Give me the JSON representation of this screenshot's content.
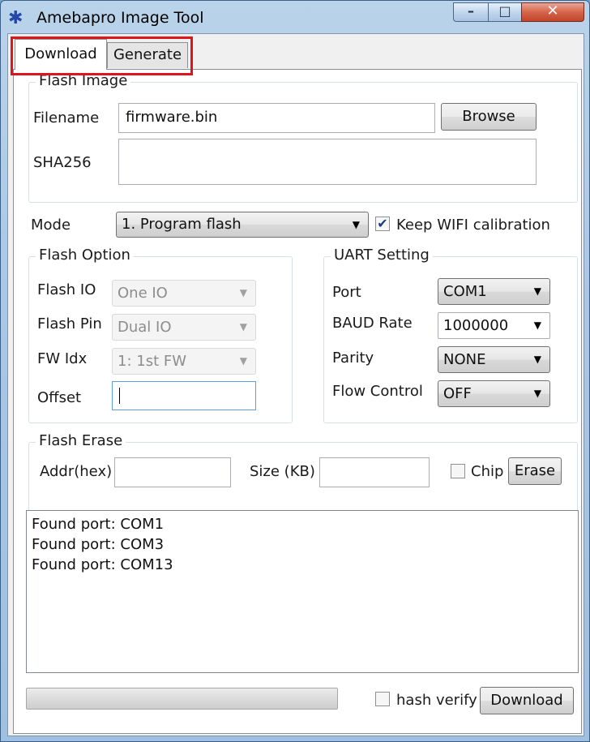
{
  "window": {
    "title": "Amebapro Image Tool",
    "minimize_glyph": "–",
    "maximize_glyph": "□",
    "close_glyph": "✕",
    "app_icon_glyph": "✱"
  },
  "tabs": [
    {
      "label": "Download",
      "selected": true
    },
    {
      "label": "Generate",
      "selected": false
    }
  ],
  "flash_image": {
    "title": "Flash Image",
    "filename_label": "Filename",
    "filename_value": "firmware.bin",
    "browse_label": "Browse",
    "sha_label": "SHA256",
    "sha_value": ""
  },
  "mode": {
    "label": "Mode",
    "selected": "1. Program flash",
    "keep_wifi_label": "Keep WIFI calibration",
    "keep_wifi_checked": true,
    "check_glyph": "✔"
  },
  "flash_option": {
    "title": "Flash Option",
    "io_label": "Flash IO",
    "io_value": "One IO",
    "pin_label": "Flash Pin",
    "pin_value": "Dual IO",
    "fw_label": "FW Idx",
    "fw_value": "1: 1st FW",
    "offset_label": "Offset",
    "offset_value": ""
  },
  "uart": {
    "title": "UART Setting",
    "port_label": "Port",
    "port_value": "COM1",
    "baud_label": "BAUD Rate",
    "baud_value": "1000000",
    "parity_label": "Parity",
    "parity_value": "NONE",
    "flow_label": "Flow Control",
    "flow_value": "OFF"
  },
  "flash_erase": {
    "title": "Flash Erase",
    "addr_label": "Addr(hex)",
    "addr_value": "",
    "size_label": "Size (KB)",
    "size_value": "",
    "chip_label": "Chip",
    "chip_checked": false,
    "erase_label": "Erase"
  },
  "log": {
    "lines": [
      "Found port: COM1",
      "Found port: COM3",
      "Found port: COM13"
    ]
  },
  "footer": {
    "progress": 0,
    "hash_verify_label": "hash verify",
    "hash_verify_checked": false,
    "download_label": "Download"
  },
  "icons": {
    "dropdown_arrow": "▼"
  },
  "colors": {
    "highlight": "#e0141b",
    "title_bar": "#a9c8e6",
    "close_button": "#c2442a",
    "check_mark": "#1b3d78"
  }
}
